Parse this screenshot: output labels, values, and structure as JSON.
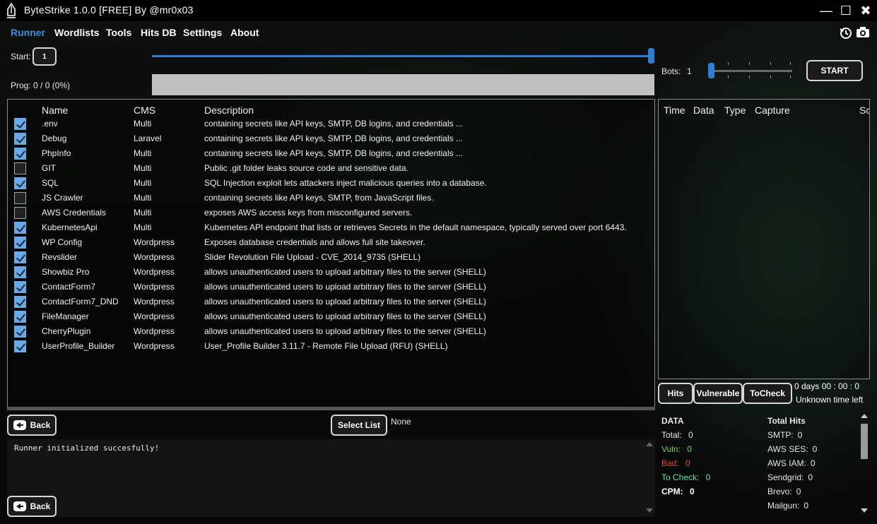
{
  "window": {
    "title": "ByteStrike 1.0.0 [FREE] By @mr0x03",
    "controls": {
      "minimize": "—",
      "maximize": "☐",
      "close": "✖"
    }
  },
  "menu": [
    "Runner",
    "Wordlists",
    "Tools",
    "Hits DB",
    "Settings",
    "About"
  ],
  "runner": {
    "start_label": "Start:",
    "start_value": "1",
    "prog_label": "Prog: 0 / 0 (0%)",
    "bots_label": "Bots:",
    "bots_value": "1",
    "start_button": "START"
  },
  "exploits": {
    "columns": [
      "Name",
      "CMS",
      "Description"
    ],
    "rows": [
      {
        "checked": true,
        "name": ".env",
        "cms": "Multi",
        "desc": "containing secrets like API keys, SMTP, DB logins, and credentials ..."
      },
      {
        "checked": true,
        "name": "Debug",
        "cms": "Laravel",
        "desc": "containing secrets like API keys, SMTP, DB logins, and credentials ..."
      },
      {
        "checked": true,
        "name": "PhpInfo",
        "cms": "Multi",
        "desc": "containing secrets like API keys, SMTP, DB logins, and credentials ..."
      },
      {
        "checked": false,
        "name": "GIT",
        "cms": "Multi",
        "desc": "Public .git folder leaks source code and sensitive data."
      },
      {
        "checked": true,
        "name": "SQL",
        "cms": "Multi",
        "desc": "SQL Injection exploit lets attackers inject malicious queries into a database."
      },
      {
        "checked": false,
        "name": "JS Crawler",
        "cms": "Multi",
        "desc": "containing secrets like API keys, SMTP, from JavaScript files."
      },
      {
        "checked": false,
        "name": "AWS Credentials",
        "cms": "Multi",
        "desc": "exposes AWS access keys from misconfigured servers."
      },
      {
        "checked": true,
        "name": "KubernetesApi",
        "cms": "Multi",
        "desc": "Kubernetes API endpoint that lists or retrieves Secrets in the default namespace, typically served over port 6443."
      },
      {
        "checked": true,
        "name": "WP Config",
        "cms": "Wordpress",
        "desc": "Exposes database credentials and allows full site takeover."
      },
      {
        "checked": true,
        "name": "Revslider",
        "cms": "Wordpress",
        "desc": "Slider Revolution File Upload - CVE_2014_9735 (SHELL)"
      },
      {
        "checked": true,
        "name": "Showbiz Pro",
        "cms": "Wordpress",
        "desc": "allows unauthenticated users to upload arbitrary files to the server (SHELL)"
      },
      {
        "checked": true,
        "name": "ContactForm7",
        "cms": "Wordpress",
        "desc": "allows unauthenticated users to upload arbitrary files to the server (SHELL)"
      },
      {
        "checked": true,
        "name": "ContactForm7_DND",
        "cms": "Wordpress",
        "desc": "allows unauthenticated users to upload arbitrary files to the server (SHELL)"
      },
      {
        "checked": true,
        "name": "FileManager",
        "cms": "Wordpress",
        "desc": "allows unauthenticated users to upload arbitrary files to the server (SHELL)"
      },
      {
        "checked": true,
        "name": "CherryPlugin",
        "cms": "Wordpress",
        "desc": "allows unauthenticated users to upload arbitrary files to the server (SHELL)"
      },
      {
        "checked": true,
        "name": "UserProfile_Builder",
        "cms": "Wordpress",
        "desc": "User_Profile Builder 3.11.7 - Remote File Upload (RFU) (SHELL)"
      }
    ]
  },
  "hits": {
    "columns": [
      "Time",
      "Data",
      "Type",
      "Capture",
      "Sc"
    ],
    "tabs": [
      "Hits",
      "Vulnerable",
      "ToCheck"
    ],
    "timer": "0  days  00 : 00 : 0",
    "time_left": "Unknown time left"
  },
  "bottom": {
    "back_label": "Back",
    "select_list_label": "Select List",
    "list_value": "None",
    "log": "Runner initialized succesfully!"
  },
  "stats": {
    "data_title": "DATA",
    "total_label": "Total:",
    "total": "0",
    "vuln_label": "Vuln:",
    "vuln": "0",
    "bad_label": "Bad:",
    "bad": "0",
    "tocheck_label": "To Check:",
    "tocheck": "0",
    "cpm_label": "CPM:",
    "cpm": "0",
    "hits_title": "Total Hits",
    "services": [
      {
        "label": "SMTP:",
        "value": "0"
      },
      {
        "label": "AWS SES:",
        "value": "0"
      },
      {
        "label": "AWS IAM:",
        "value": "0"
      },
      {
        "label": "Sendgrid:",
        "value": "0"
      },
      {
        "label": "Brevo:",
        "value": "0"
      },
      {
        "label": "Mailgun:",
        "value": "0"
      }
    ]
  },
  "colors": {
    "accent": "#3b8fe0",
    "vuln": "#7ad34a",
    "bad": "#e0483a",
    "tocheck": "#66e0a8"
  }
}
